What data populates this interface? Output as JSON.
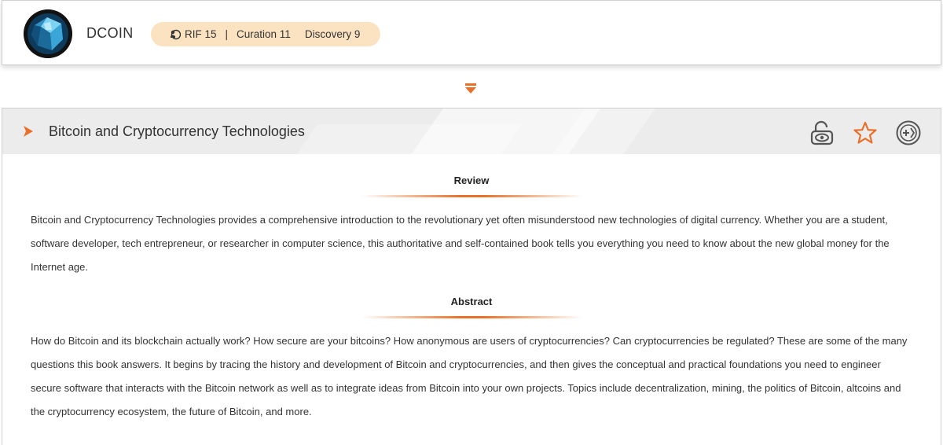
{
  "user": {
    "name": "DCOIN",
    "avatar_icon": "crystal-avatar-icon"
  },
  "stats": {
    "rif_label": "RIF 15",
    "separator": "|",
    "curation_label": "Curation 11",
    "discovery_label": "Discovery 9",
    "rif_icon": "people-icon"
  },
  "expand_icon": "double-chevron-down-icon",
  "book": {
    "title": "Bitcoin and Cryptocurrency Technologies",
    "actions": {
      "unlock_icon": "unlock-eye-icon",
      "favorite_icon": "star-icon",
      "add_icon": "add-circle-icon"
    }
  },
  "review": {
    "heading": "Review",
    "text": "Bitcoin and Cryptocurrency Technologies provides a comprehensive introduction to the revolutionary yet often misunderstood new technologies of digital currency. Whether you are a student, software developer, tech entrepreneur, or researcher in computer science, this authoritative and self-contained book tells you everything you need to know about the new global money for the Internet age."
  },
  "abstract": {
    "heading": "Abstract",
    "text": "How do Bitcoin and its blockchain actually work? How secure are your bitcoins? How anonymous are users of cryptocurrencies? Can cryptocurrencies be regulated? These are some of the many questions this book answers. It begins by tracing the history and development of Bitcoin and cryptocurrencies, and then gives the conceptual and practical foundations you need to engineer secure software that interacts with the Bitcoin network as well as to integrate ideas from Bitcoin into your own projects. Topics include decentralization, mining, the politics of Bitcoin, altcoins and the cryptocurrency ecosystem, the future of Bitcoin, and more."
  },
  "colors": {
    "accent": "#e8702a",
    "pill_background": "#fbe3c2",
    "title_bar_background": "#ececec"
  }
}
